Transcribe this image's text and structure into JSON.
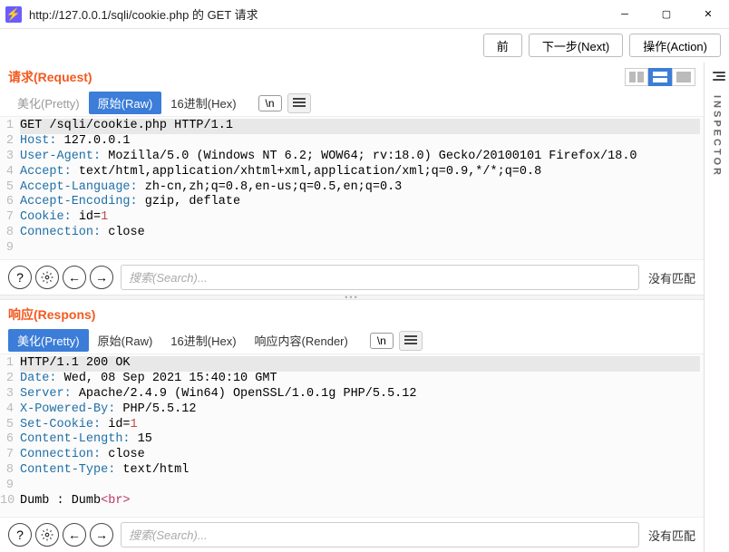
{
  "window": {
    "app_icon": "⚡",
    "title": "http://127.0.0.1/sqli/cookie.php 的 GET 请求"
  },
  "toolbar": {
    "back": "前",
    "next": "下一步(Next)",
    "action": "操作(Action)"
  },
  "request": {
    "title": "请求(Request)",
    "tabs": {
      "pretty": "美化(Pretty)",
      "raw": "原始(Raw)",
      "hex": "16进制(Hex)",
      "literal": "\\n"
    },
    "lines": [
      {
        "n": 1,
        "html": "<span class='line1'>GET /sqli/cookie.php HTTP/1.1</span>"
      },
      {
        "n": 2,
        "html": "<span class='hk'>Host:</span> 127.0.0.1"
      },
      {
        "n": 3,
        "html": "<span class='hk'>User-Agent:</span> Mozilla/5.0 (Windows NT 6.2; WOW64; rv:18.0) Gecko/20100101 Firefox/18.0"
      },
      {
        "n": 4,
        "html": "<span class='hk'>Accept:</span> text/html,application/xhtml+xml,application/xml;q=0.9,*/*;q=0.8"
      },
      {
        "n": 5,
        "html": "<span class='hk'>Accept-Language:</span> zh-cn,zh;q=0.8,en-us;q=0.5,en;q=0.3"
      },
      {
        "n": 6,
        "html": "<span class='hk'>Accept-Encoding:</span> gzip, deflate"
      },
      {
        "n": 7,
        "html": "<span class='hk'>Cookie:</span> id=<span class='num'>1</span>"
      },
      {
        "n": 8,
        "html": "<span class='hk'>Connection:</span> close"
      },
      {
        "n": 9,
        "html": ""
      }
    ],
    "search": {
      "placeholder": "搜索(Search)...",
      "nomatch": "没有匹配"
    }
  },
  "response": {
    "title": "响应(Respons)",
    "tabs": {
      "pretty": "美化(Pretty)",
      "raw": "原始(Raw)",
      "hex": "16进制(Hex)",
      "render": "响应内容(Render)",
      "literal": "\\n"
    },
    "lines": [
      {
        "n": 1,
        "html": "<span class='line1'>HTTP/1.1 200 OK</span>"
      },
      {
        "n": 2,
        "html": "<span class='hk'>Date:</span> Wed, 08 Sep 2021 15:40:10 GMT"
      },
      {
        "n": 3,
        "html": "<span class='hk'>Server:</span> Apache/2.4.9 (Win64) OpenSSL/1.0.1g PHP/5.5.12"
      },
      {
        "n": 4,
        "html": "<span class='hk'>X-Powered-By:</span> PHP/5.5.12"
      },
      {
        "n": 5,
        "html": "<span class='hk'>Set-Cookie:</span> id=<span class='num'>1</span>"
      },
      {
        "n": 6,
        "html": "<span class='hk'>Content-Length:</span> 15"
      },
      {
        "n": 7,
        "html": "<span class='hk'>Connection:</span> close"
      },
      {
        "n": 8,
        "html": "<span class='hk'>Content-Type:</span> text/html"
      },
      {
        "n": 9,
        "html": ""
      },
      {
        "n": 10,
        "html": "Dumb : Dumb<span class='tag'>&lt;br&gt;</span>"
      }
    ],
    "search": {
      "placeholder": "搜索(Search)...",
      "nomatch": "没有匹配"
    }
  },
  "inspector_label": "INSPECTOR"
}
